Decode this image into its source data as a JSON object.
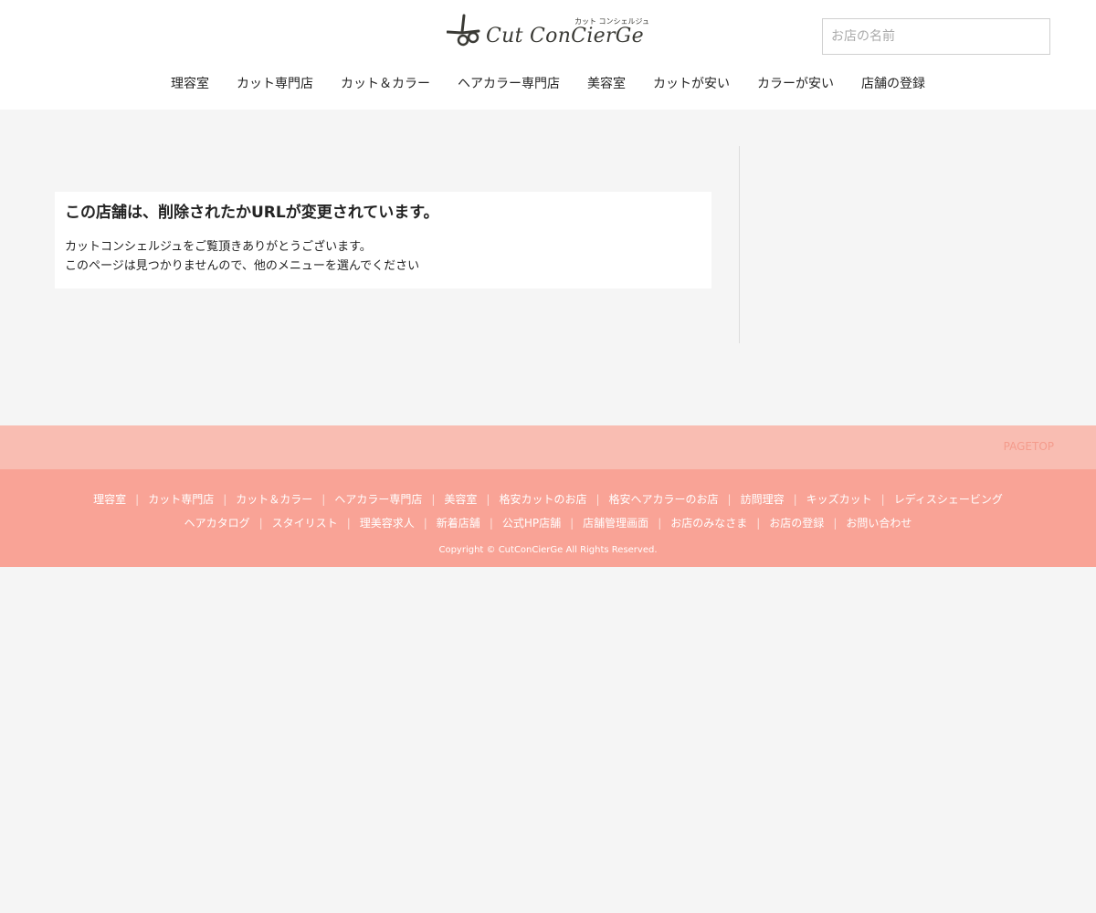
{
  "header": {
    "logo_text": "Cut ConCierGe",
    "logo_kana": "カット コンシェルジュ",
    "search_placeholder": "お店の名前"
  },
  "nav": [
    "理容室",
    "カット専門店",
    "カット＆カラー",
    "ヘアカラー専門店",
    "美容室",
    "カットが安い",
    "カラーが安い",
    "店舗の登録"
  ],
  "main": {
    "title": "この店舗は、削除されたかURLが変更されています。",
    "line1": "カットコンシェルジュをご覧頂きありがとうございます。",
    "line2": "このページは見つかりませんので、他のメニューを選んでください"
  },
  "pagetop": "PAGETOP",
  "footer": {
    "row1": [
      "理容室",
      "カット専門店",
      "カット＆カラー",
      "ヘアカラー専門店",
      "美容室",
      "格安カットのお店",
      "格安ヘアカラーのお店",
      "訪問理容",
      "キッズカット",
      "レディスシェービング"
    ],
    "row2": [
      "ヘアカタログ",
      "スタイリスト",
      "理美容求人",
      "新着店舗",
      "公式HP店舗",
      "店舗管理画面",
      "お店のみなさま",
      "お店の登録",
      "お問い合わせ"
    ],
    "separator": "|",
    "copyright": "Copyright © CutConCierGe All Rights Reserved."
  },
  "colors": {
    "page_bg": "#f5f5f5",
    "pagetop_bar": "#f9bdb2",
    "footer_bg": "#f9a396",
    "logo": "#3a3a35"
  }
}
